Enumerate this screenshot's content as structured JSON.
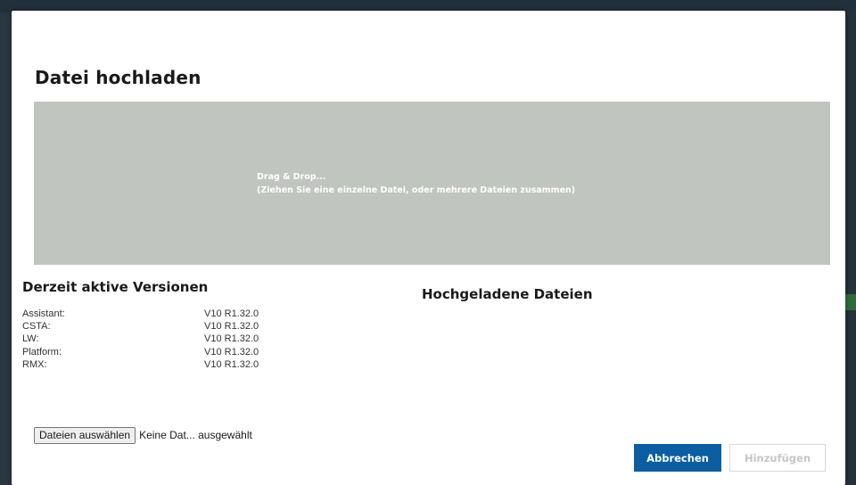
{
  "dialog": {
    "title": "Datei hochladen"
  },
  "dropzone": {
    "line1": "Drag & Drop...",
    "line2": "(Ziehen Sie eine einzelne Datei, oder mehrere Dateien zusammen)"
  },
  "versions": {
    "title": "Derzeit aktive Versionen",
    "items": [
      {
        "name": "Assistant:",
        "value": "V10 R1.32.0"
      },
      {
        "name": "CSTA:",
        "value": "V10 R1.32.0"
      },
      {
        "name": "LW:",
        "value": "V10 R1.32.0"
      },
      {
        "name": "Platform:",
        "value": "V10 R1.32.0"
      },
      {
        "name": "RMX:",
        "value": "V10 R1.32.0"
      }
    ]
  },
  "uploaded": {
    "title": "Hochgeladene Dateien"
  },
  "file_input": {
    "button_label": "Dateien auswählen",
    "status": "Keine Dat... ausgewählt"
  },
  "actions": {
    "cancel_label": "Abbrechen",
    "add_label": "Hinzufügen"
  },
  "colors": {
    "primary": "#0a5ea1",
    "dropzone": "#c1c5c0",
    "disabled_text": "#c6c6c6"
  }
}
